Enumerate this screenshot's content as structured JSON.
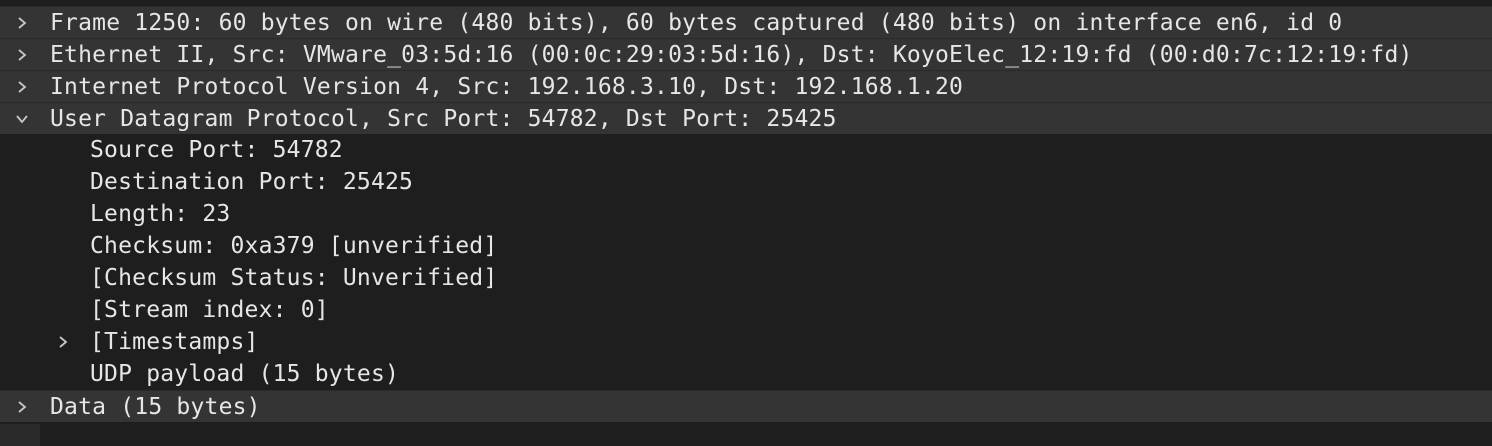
{
  "tree": {
    "frame": "Frame 1250: 60 bytes on wire (480 bits), 60 bytes captured (480 bits) on interface en6, id 0",
    "ethernet": "Ethernet II, Src: VMware_03:5d:16 (00:0c:29:03:5d:16), Dst: KoyoElec_12:19:fd (00:d0:7c:12:19:fd)",
    "ipv4": "Internet Protocol Version 4, Src: 192.168.3.10, Dst: 192.168.1.20",
    "udp": "User Datagram Protocol, Src Port: 54782, Dst Port: 25425",
    "udp_fields": {
      "source_port": "Source Port: 54782",
      "destination_port": "Destination Port: 25425",
      "length": "Length: 23",
      "checksum": "Checksum: 0xa379 [unverified]",
      "checksum_status": "[Checksum Status: Unverified]",
      "stream_index": "[Stream index: 0]",
      "timestamps": "[Timestamps]",
      "payload": "UDP payload (15 bytes)"
    },
    "data": "Data (15 bytes)"
  },
  "icons": {
    "collapsed": "chevron-right-icon",
    "expanded": "chevron-down-icon"
  },
  "colors": {
    "background": "#1e1e1e",
    "top_level_row": "#343434",
    "text": "#e6e6e6"
  }
}
